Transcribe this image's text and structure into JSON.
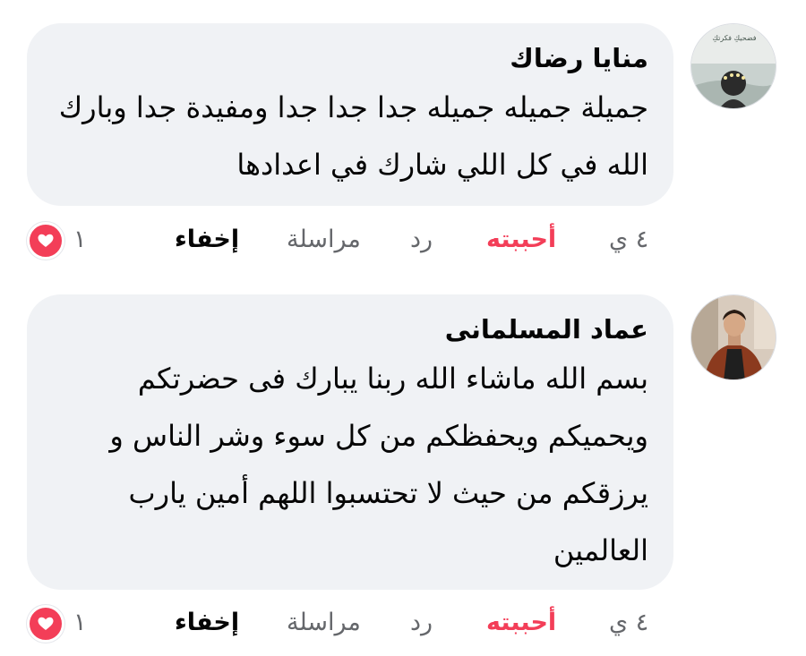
{
  "comments": [
    {
      "author": "منايا رضاك",
      "avatar_caption": "فضحيكِ فكرتكِ",
      "text": "جميلة جميله جميله جدا جدا جدا  ومفيدة جدا وبارك الله في كل اللي شارك في اعدادها",
      "time": "٤ ي",
      "like_label": "أحببته",
      "reply_label": "رد",
      "message_label": "مراسلة",
      "hide_label": "إخفاء",
      "reaction_count": "١",
      "reaction_icon": "heart-icon"
    },
    {
      "author": "عماد المسلمانى",
      "text": "بسم الله ماشاء الله ربنا يبارك فى حضرتكم ويحميكم ويحفظكم من كل سوء وشر الناس و يرزقكم من حيث لا تحتسبوا اللهم أمين يارب العالمين",
      "time": "٤ ي",
      "like_label": "أحببته",
      "reply_label": "رد",
      "message_label": "مراسلة",
      "hide_label": "إخفاء",
      "reaction_count": "١",
      "reaction_icon": "heart-icon"
    }
  ],
  "colors": {
    "bubble": "#f0f2f5",
    "like": "#f33e58",
    "meta": "#65676b",
    "text": "#050505"
  }
}
